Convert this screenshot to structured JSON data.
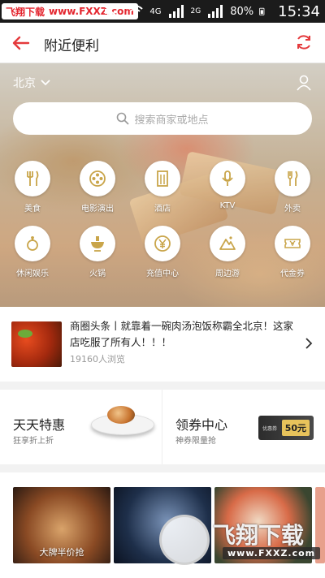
{
  "statusbar": {
    "watermark_cn": "飞翔下载",
    "watermark_url": "www.FXXZ.com",
    "signal_4g_label": "4G",
    "signal_2g_label": "2G",
    "battery": "80%",
    "time": "15:34"
  },
  "header": {
    "title": "附近便利"
  },
  "hero": {
    "city": "北京",
    "search_placeholder": "搜索商家或地点",
    "categories": [
      {
        "label": "美食",
        "icon": "utensils-icon"
      },
      {
        "label": "电影演出",
        "icon": "film-reel-icon"
      },
      {
        "label": "酒店",
        "icon": "hotel-icon"
      },
      {
        "label": "KTV",
        "icon": "microphone-icon"
      },
      {
        "label": "外卖",
        "icon": "fork-knife-icon"
      },
      {
        "label": "休闲娱乐",
        "icon": "bowling-icon"
      },
      {
        "label": "火锅",
        "icon": "hotpot-icon"
      },
      {
        "label": "充值中心",
        "icon": "yuan-coin-icon"
      },
      {
        "label": "周边游",
        "icon": "mountain-icon"
      },
      {
        "label": "代金券",
        "icon": "ticket-icon"
      }
    ]
  },
  "news": {
    "text": "商圈头条丨就靠着一碗肉汤泡饭称霸全北京！这家店吃服了所有人！！！",
    "views": "19160人浏览"
  },
  "promo": {
    "left_title": "天天特惠",
    "left_sub": "狂享折上折",
    "right_title": "领券中心",
    "right_sub": "神券限量抢",
    "coupon_label": "优惠券",
    "coupon_value": "50元"
  },
  "tiles": [
    {
      "caption": "大牌半价抢"
    },
    {
      "caption": ""
    },
    {
      "caption": ""
    }
  ],
  "footer_watermark": {
    "big": "飞翔下载",
    "small": "www.FXXZ.com"
  },
  "colors": {
    "accent": "#e4393c",
    "icon_gold": "#c9a54a"
  }
}
